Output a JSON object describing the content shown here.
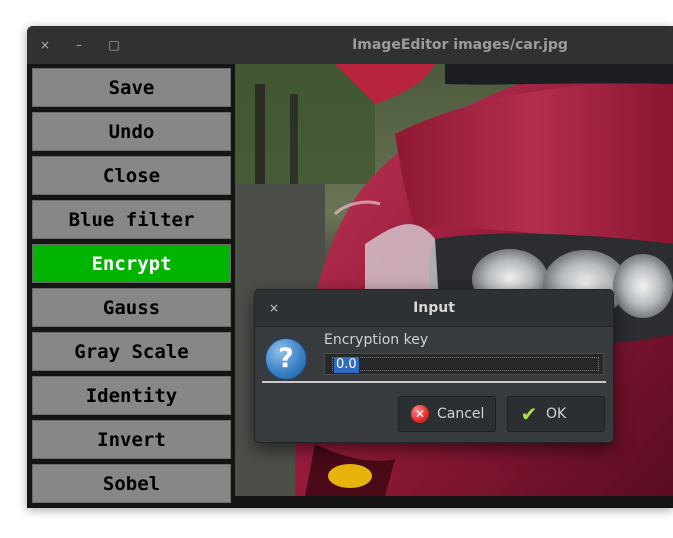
{
  "window": {
    "title": "ImageEditor images/car.jpg",
    "controls": {
      "close": "×",
      "minimize": "–",
      "maximize": "□"
    }
  },
  "sidebar": {
    "buttons": [
      {
        "label": "Save"
      },
      {
        "label": "Undo"
      },
      {
        "label": "Close"
      },
      {
        "label": "Blue filter"
      },
      {
        "label": "Encrypt",
        "active": true
      },
      {
        "label": "Gauss"
      },
      {
        "label": "Gray Scale"
      },
      {
        "label": "Identity"
      },
      {
        "label": "Invert"
      },
      {
        "label": "Sobel"
      }
    ],
    "active_color": "#00b400",
    "button_color": "#878787"
  },
  "image": {
    "subject": "red car front close-up"
  },
  "dialog": {
    "title": "Input",
    "close": "×",
    "icon": "question-icon",
    "label": "Encryption key",
    "input_value": "0.0",
    "cancel_label": "Cancel",
    "ok_label": "OK",
    "cancel_icon": "cancel-icon",
    "ok_icon": "checkmark-icon"
  }
}
